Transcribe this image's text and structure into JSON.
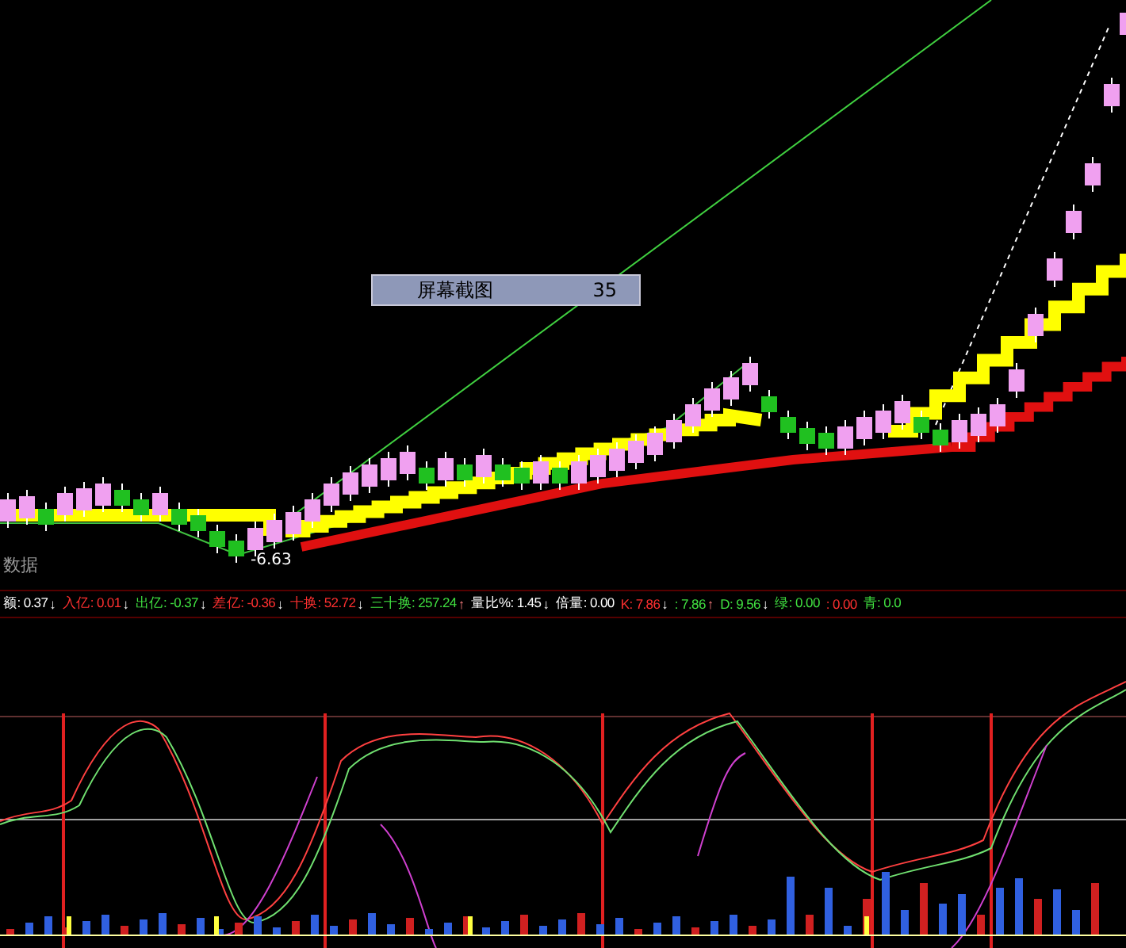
{
  "main_chart": {
    "low_label": "-6.63",
    "corner_label": "数据",
    "tooltip": {
      "title": "屏幕截图",
      "value": "35"
    }
  },
  "indicator_bar": [
    {
      "text": "额: 0.37",
      "arrow": "↓",
      "color": "#ffffff"
    },
    {
      "text": "入亿: 0.01",
      "arrow": "↓",
      "color": "#ff3030"
    },
    {
      "text": "出亿: -0.37",
      "arrow": "↓",
      "color": "#40e040"
    },
    {
      "text": "差亿: -0.36",
      "arrow": "↓",
      "color": "#ff3030"
    },
    {
      "text": "十换: 52.72",
      "arrow": "↓",
      "color": "#ff3030"
    },
    {
      "text": "三十换: 257.24",
      "arrow": "↑",
      "color": "#40e040"
    },
    {
      "text": "量比%: 1.45",
      "arrow": "↓",
      "color": "#ffffff"
    },
    {
      "text": "倍量: 0.00",
      "color": "#ffffff"
    },
    {
      "text": "K: 7.86",
      "arrow": "↓",
      "color": "#ff3030"
    },
    {
      "text": ": 7.86",
      "arrow": "↑",
      "color": "#40e040"
    },
    {
      "text": "D: 9.56",
      "arrow": "↓",
      "color": "#40e040"
    },
    {
      "text": "绿: 0.00",
      "color": "#40e040"
    },
    {
      "text": ": 0.00",
      "color": "#ff3030"
    },
    {
      "text": "青: 0.0",
      "color": "#40e040"
    }
  ]
}
